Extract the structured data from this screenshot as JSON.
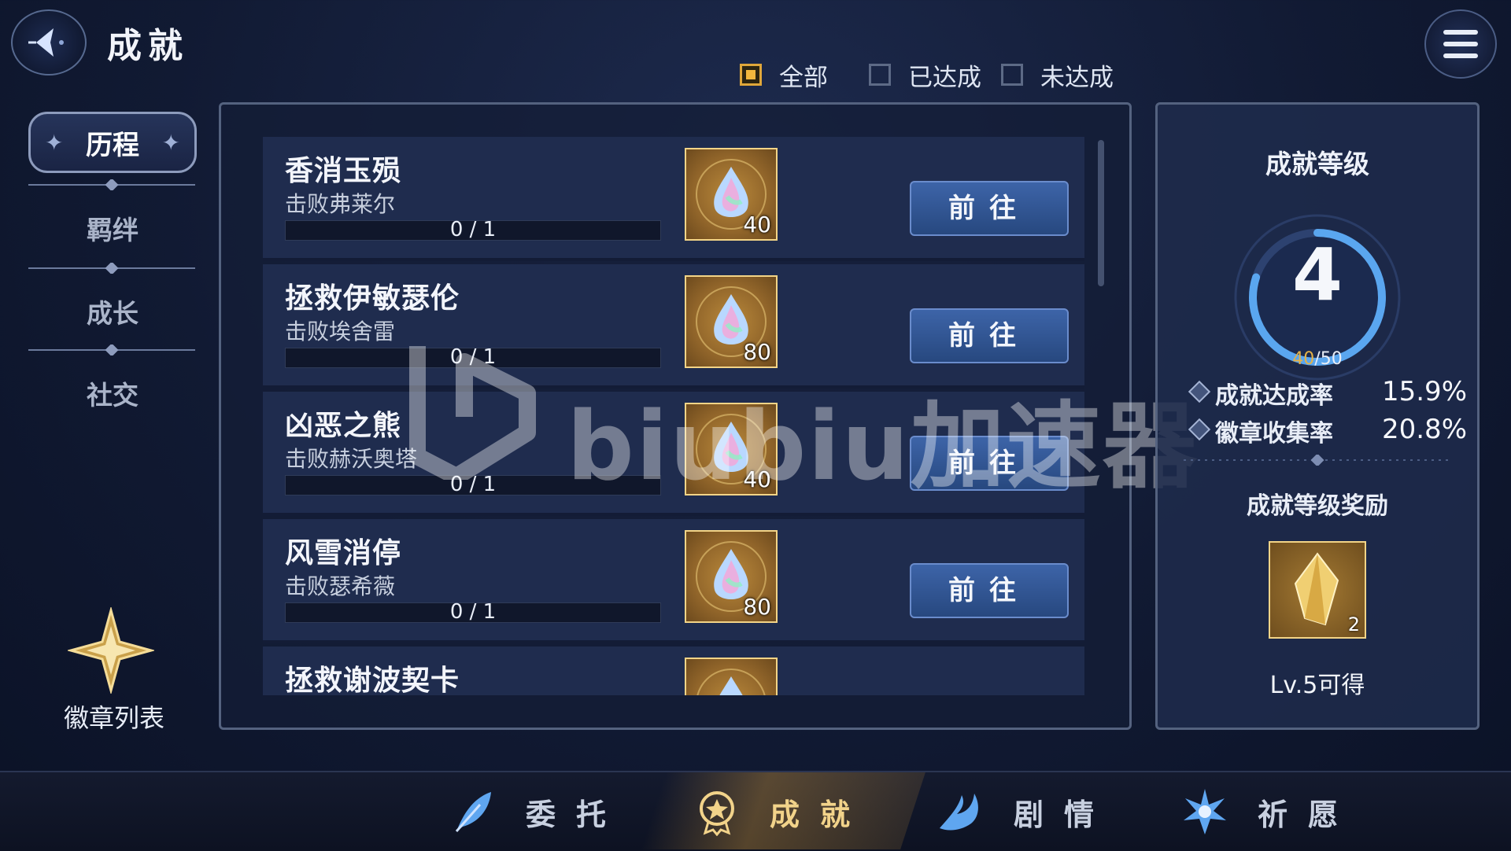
{
  "header": {
    "title": "成就",
    "back_icon": "back-arrow-icon",
    "menu_icon": "hamburger-menu-icon"
  },
  "filters": [
    {
      "label": "全部",
      "checked": true
    },
    {
      "label": "已达成",
      "checked": false
    },
    {
      "label": "未达成",
      "checked": false
    }
  ],
  "sidebar": {
    "categories": [
      {
        "label": "历程",
        "active": true
      },
      {
        "label": "羁绊",
        "active": false
      },
      {
        "label": "成长",
        "active": false
      },
      {
        "label": "社交",
        "active": false
      }
    ],
    "badge_list_label": "徽章列表"
  },
  "achievements": [
    {
      "name": "香消玉殒",
      "desc": "击败弗莱尔",
      "progress_text": "0 / 1",
      "progress": 0,
      "reward_qty": "40",
      "button": "前往"
    },
    {
      "name": "拯救伊敏瑟伦",
      "desc": "击败埃舍雷",
      "progress_text": "0 / 1",
      "progress": 0,
      "reward_qty": "80",
      "button": "前往"
    },
    {
      "name": "凶恶之熊",
      "desc": "击败赫沃奥塔",
      "progress_text": "0 / 1",
      "progress": 0,
      "reward_qty": "40",
      "button": "前往"
    },
    {
      "name": "风雪消停",
      "desc": "击败瑟希薇",
      "progress_text": "0 / 1",
      "progress": 0,
      "reward_qty": "80",
      "button": "前往"
    },
    {
      "name": "拯救谢波契卡",
      "desc": "",
      "progress_text": "",
      "progress": 0,
      "reward_qty": "",
      "button": ""
    }
  ],
  "level_panel": {
    "title": "成就等级",
    "level": "4",
    "progress_current": "40",
    "progress_total": "/50",
    "progress_ratio": 0.8,
    "stats": [
      {
        "label": "成就达成率",
        "value": "15.9%"
      },
      {
        "label": "徽章收集率",
        "value": "20.8%"
      }
    ],
    "reward_title": "成就等级奖励",
    "reward_qty": "2",
    "reward_requirement": "Lv.5可得"
  },
  "bottom_nav": [
    {
      "label": "委托",
      "icon": "feather-icon",
      "active": false
    },
    {
      "label": "成就",
      "icon": "achievement-medal-icon",
      "active": true
    },
    {
      "label": "剧情",
      "icon": "story-wave-icon",
      "active": false
    },
    {
      "label": "祈愿",
      "icon": "wish-star-icon",
      "active": false
    }
  ],
  "watermark": "biubiu加速器",
  "colors": {
    "accent_gold": "#e0b84a",
    "button_blue": "#3d64a8",
    "ring_blue": "#5aa6ef"
  }
}
